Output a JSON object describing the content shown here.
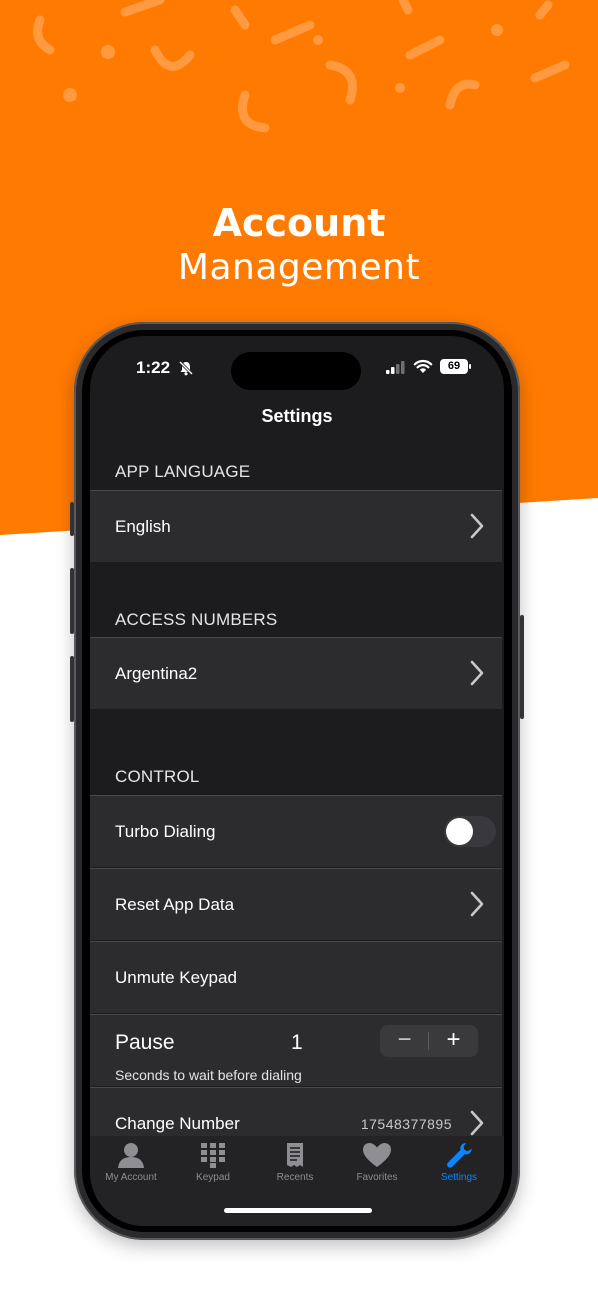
{
  "promo": {
    "headline_bold": "Account",
    "headline_light": "Management",
    "accent_color": "#ff7a00"
  },
  "status_bar": {
    "time": "1:22",
    "battery": "69"
  },
  "nav": {
    "title": "Settings"
  },
  "sections": {
    "app_language": {
      "header": "APP LANGUAGE",
      "value": "English"
    },
    "access_numbers": {
      "header": "ACCESS NUMBERS",
      "value": "Argentina2"
    },
    "control": {
      "header": "CONTROL",
      "turbo_dialing": {
        "label": "Turbo Dialing",
        "enabled": false
      },
      "reset_app_data": {
        "label": "Reset App Data"
      },
      "unmute_keypad": {
        "label": "Unmute Keypad"
      },
      "pause": {
        "label": "Pause",
        "value": "1",
        "subtitle": "Seconds to wait before dialing",
        "minus": "−",
        "plus": "+"
      },
      "change_number": {
        "label": "Change Number",
        "value": "17548377895"
      }
    }
  },
  "tabs": [
    {
      "label": "My Account",
      "icon": "person-icon",
      "active": false
    },
    {
      "label": "Keypad",
      "icon": "keypad-icon",
      "active": false
    },
    {
      "label": "Recents",
      "icon": "receipt-icon",
      "active": false
    },
    {
      "label": "Favorites",
      "icon": "heart-icon",
      "active": false
    },
    {
      "label": "Settings",
      "icon": "wrench-icon",
      "active": true
    }
  ]
}
